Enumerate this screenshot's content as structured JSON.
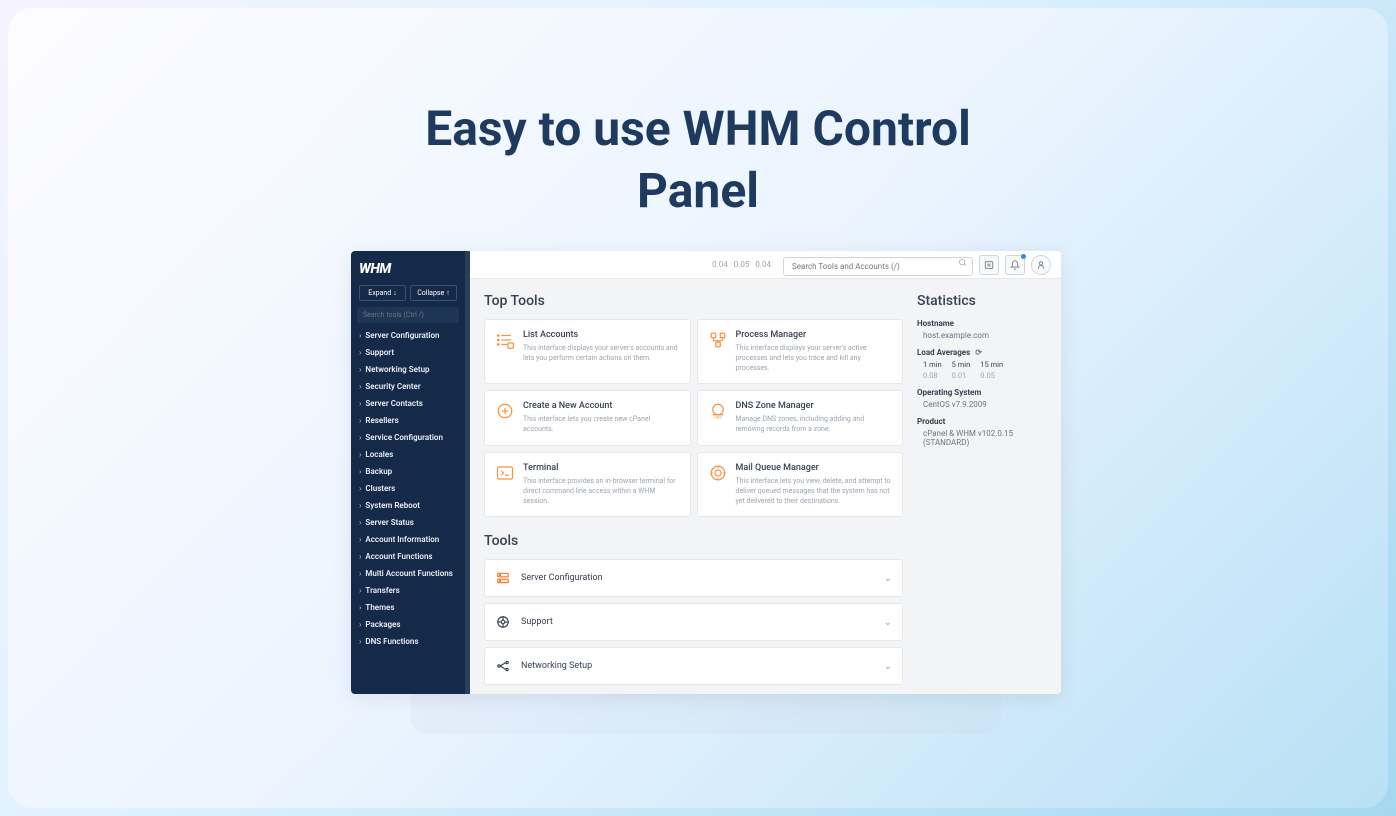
{
  "hero": {
    "title_line1": "Easy to use WHM Control",
    "title_line2": "Panel"
  },
  "brand": "WHM",
  "side_buttons": {
    "expand": "Expand",
    "collapse": "Collapse"
  },
  "side_search": {
    "placeholder": "Search tools (Ctrl /)"
  },
  "nav_items": [
    "Server Configuration",
    "Support",
    "Networking Setup",
    "Security Center",
    "Server Contacts",
    "Resellers",
    "Service Configuration",
    "Locales",
    "Backup",
    "Clusters",
    "System Reboot",
    "Server Status",
    "Account Information",
    "Account Functions",
    "Multi Account Functions",
    "Transfers",
    "Themes",
    "Packages",
    "DNS Functions"
  ],
  "topbar": {
    "loads": [
      "0.04",
      "0.05",
      "0.04"
    ],
    "search_placeholder": "Search Tools and Accounts (/)"
  },
  "sections": {
    "top_tools": "Top Tools",
    "tools": "Tools",
    "statistics": "Statistics"
  },
  "top_tools": [
    {
      "title": "List Accounts",
      "desc": "This interface displays your server's accounts and lets you perform certain actions on them.",
      "icon": "list"
    },
    {
      "title": "Process Manager",
      "desc": "This interface displays your server's active processes and lets you trace and kill any processes.",
      "icon": "process"
    },
    {
      "title": "Create a New Account",
      "desc": "This interface lets you create new cPanel accounts.",
      "icon": "create"
    },
    {
      "title": "DNS Zone Manager",
      "desc": "Manage DNS zones, including adding and removing records from a zone.",
      "icon": "dns"
    },
    {
      "title": "Terminal",
      "desc": "This interface provides an in-browser terminal for direct command line access within a WHM session.",
      "icon": "terminal"
    },
    {
      "title": "Mail Queue Manager",
      "desc": "This interface lets you view, delete, and attempt to deliver queued messages that the system has not yet delivered to their destinations.",
      "icon": "mail"
    }
  ],
  "tool_rows": [
    {
      "title": "Server Configuration",
      "icon": "server"
    },
    {
      "title": "Support",
      "icon": "support"
    },
    {
      "title": "Networking Setup",
      "icon": "network"
    }
  ],
  "stats": {
    "hostname_label": "Hostname",
    "hostname_value": "host.example.com",
    "load_label": "Load Averages",
    "load_headers": [
      "1 min",
      "5 min",
      "15 min"
    ],
    "load_values": [
      "0.08",
      "0.01",
      "0.05"
    ],
    "os_label": "Operating System",
    "os_value": "CentOS v7.9.2009",
    "product_label": "Product",
    "product_value": "cPanel & WHM v102.0.15 (STANDARD)"
  }
}
